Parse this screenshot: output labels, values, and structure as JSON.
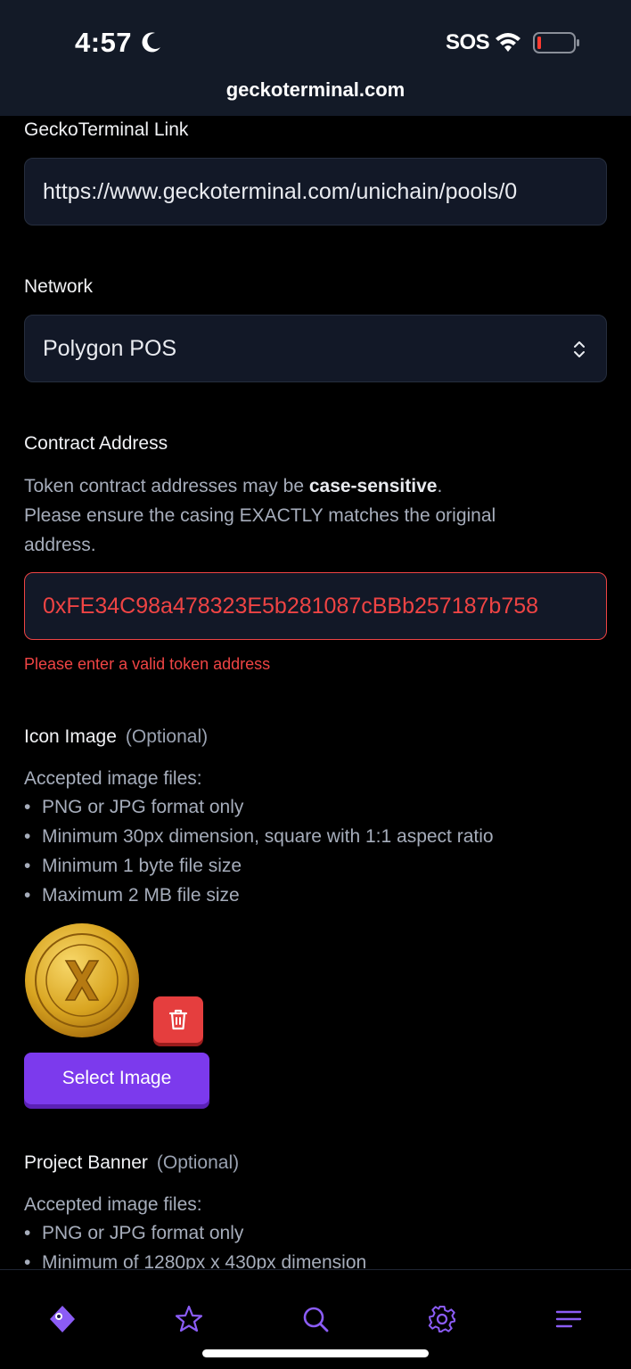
{
  "status_bar": {
    "time": "4:57",
    "carrier": "SOS"
  },
  "browser": {
    "url": "geckoterminal.com"
  },
  "form": {
    "gecko_link": {
      "label": "GeckoTerminal Link",
      "value": "https://www.geckoterminal.com/unichain/pools/0"
    },
    "network": {
      "label": "Network",
      "selected": "Polygon POS"
    },
    "contract": {
      "label": "Contract Address",
      "help_prefix": "Token contract addresses may be ",
      "help_bold": "case-sensitive",
      "help_suffix": ".",
      "help_line2": "Please ensure the casing EXACTLY matches the original",
      "help_line3": "address.",
      "value": "0xFE34C98a478323E5b281087cBBb257187b758",
      "error": "Please enter a valid token address"
    },
    "icon_image": {
      "label": "Icon Image",
      "optional": "(Optional)",
      "accepted_title": "Accepted image files:",
      "rules": [
        "PNG or JPG format only",
        "Minimum 30px dimension, square with 1:1 aspect ratio",
        "Minimum 1 byte file size",
        "Maximum 2 MB file size"
      ],
      "select_label": "Select Image"
    },
    "project_banner": {
      "label": "Project Banner",
      "optional": "(Optional)",
      "accepted_title": "Accepted image files:",
      "rules": [
        "PNG or JPG format only",
        "Minimum of 1280px x 430px dimension"
      ]
    }
  },
  "colors": {
    "accent": "#7c3aed",
    "error": "#ef4444",
    "field_bg": "#121827"
  },
  "bottom_nav": [
    "gecko-logo-icon",
    "star-icon",
    "search-icon",
    "gear-icon",
    "menu-icon"
  ]
}
